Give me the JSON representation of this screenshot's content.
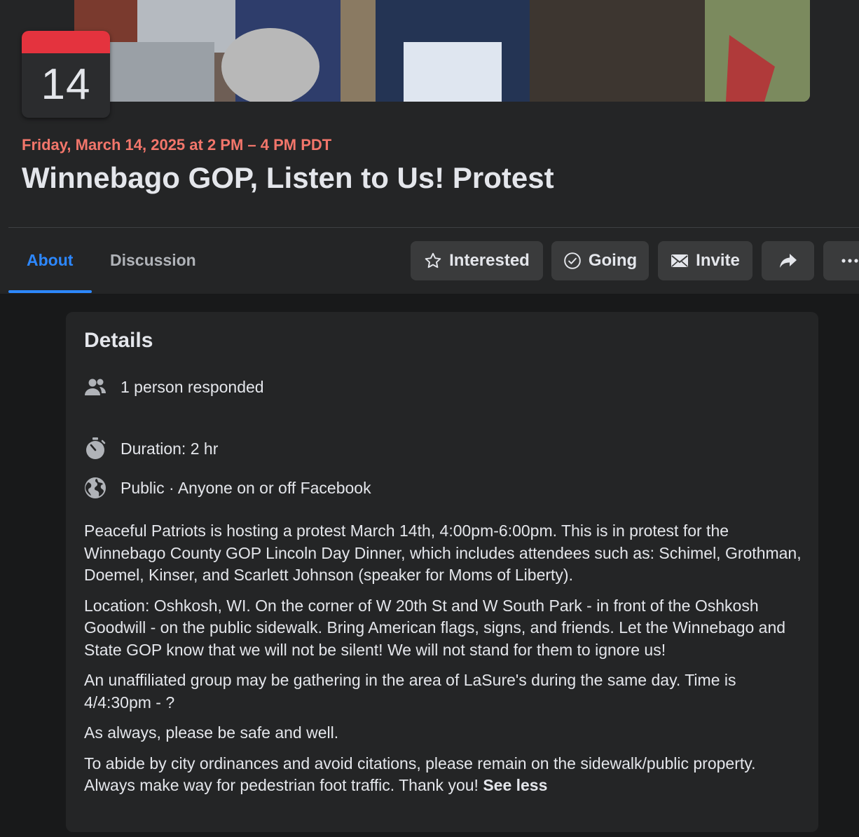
{
  "calendar": {
    "day": "14",
    "accent": "#e4333e"
  },
  "event": {
    "date_line": "Friday, March 14, 2025 at 2 PM – 4 PM PDT",
    "title": "Winnebago GOP, Listen to Us! Protest"
  },
  "tabs": [
    {
      "label": "About",
      "active": true
    },
    {
      "label": "Discussion",
      "active": false
    }
  ],
  "actions": {
    "interested": "Interested",
    "going": "Going",
    "invite": "Invite",
    "share_icon": "share-arrow-icon",
    "more_icon": "more-dots-icon"
  },
  "details": {
    "heading": "Details",
    "responded": "1 person responded",
    "duration": "Duration: 2 hr",
    "privacy": "Public · Anyone on or off Facebook",
    "paragraphs": [
      "Peaceful Patriots is hosting a protest March 14th, 4:00pm-6:00pm. This is in protest for the Winnebago County GOP Lincoln Day Dinner, which includes attendees such as: Schimel, Grothman, Doemel, Kinser, and Scarlett Johnson (speaker for Moms of Liberty).",
      "Location: Oshkosh, WI. On the corner of W 20th St and W South Park - in front of the Oshkosh Goodwill - on the public sidewalk. Bring American flags, signs, and friends. Let the Winnebago and State GOP know that we will not be silent! We will not stand for them to ignore us!",
      "An unaffiliated group may be gathering in the area of LaSure's during the same day. Time is 4/4:30pm - ?",
      "As always, please be safe and well.",
      "To abide by city ordinances and avoid citations, please remain on the sidewalk/public property. Always make way for pedestrian foot traffic. Thank you!"
    ],
    "see_less": "See less"
  },
  "colors": {
    "date_accent": "#f3766b",
    "tab_active": "#2d88ff",
    "button_bg": "#3a3b3c",
    "card_bg": "#242526",
    "page_bg": "#18191a"
  }
}
